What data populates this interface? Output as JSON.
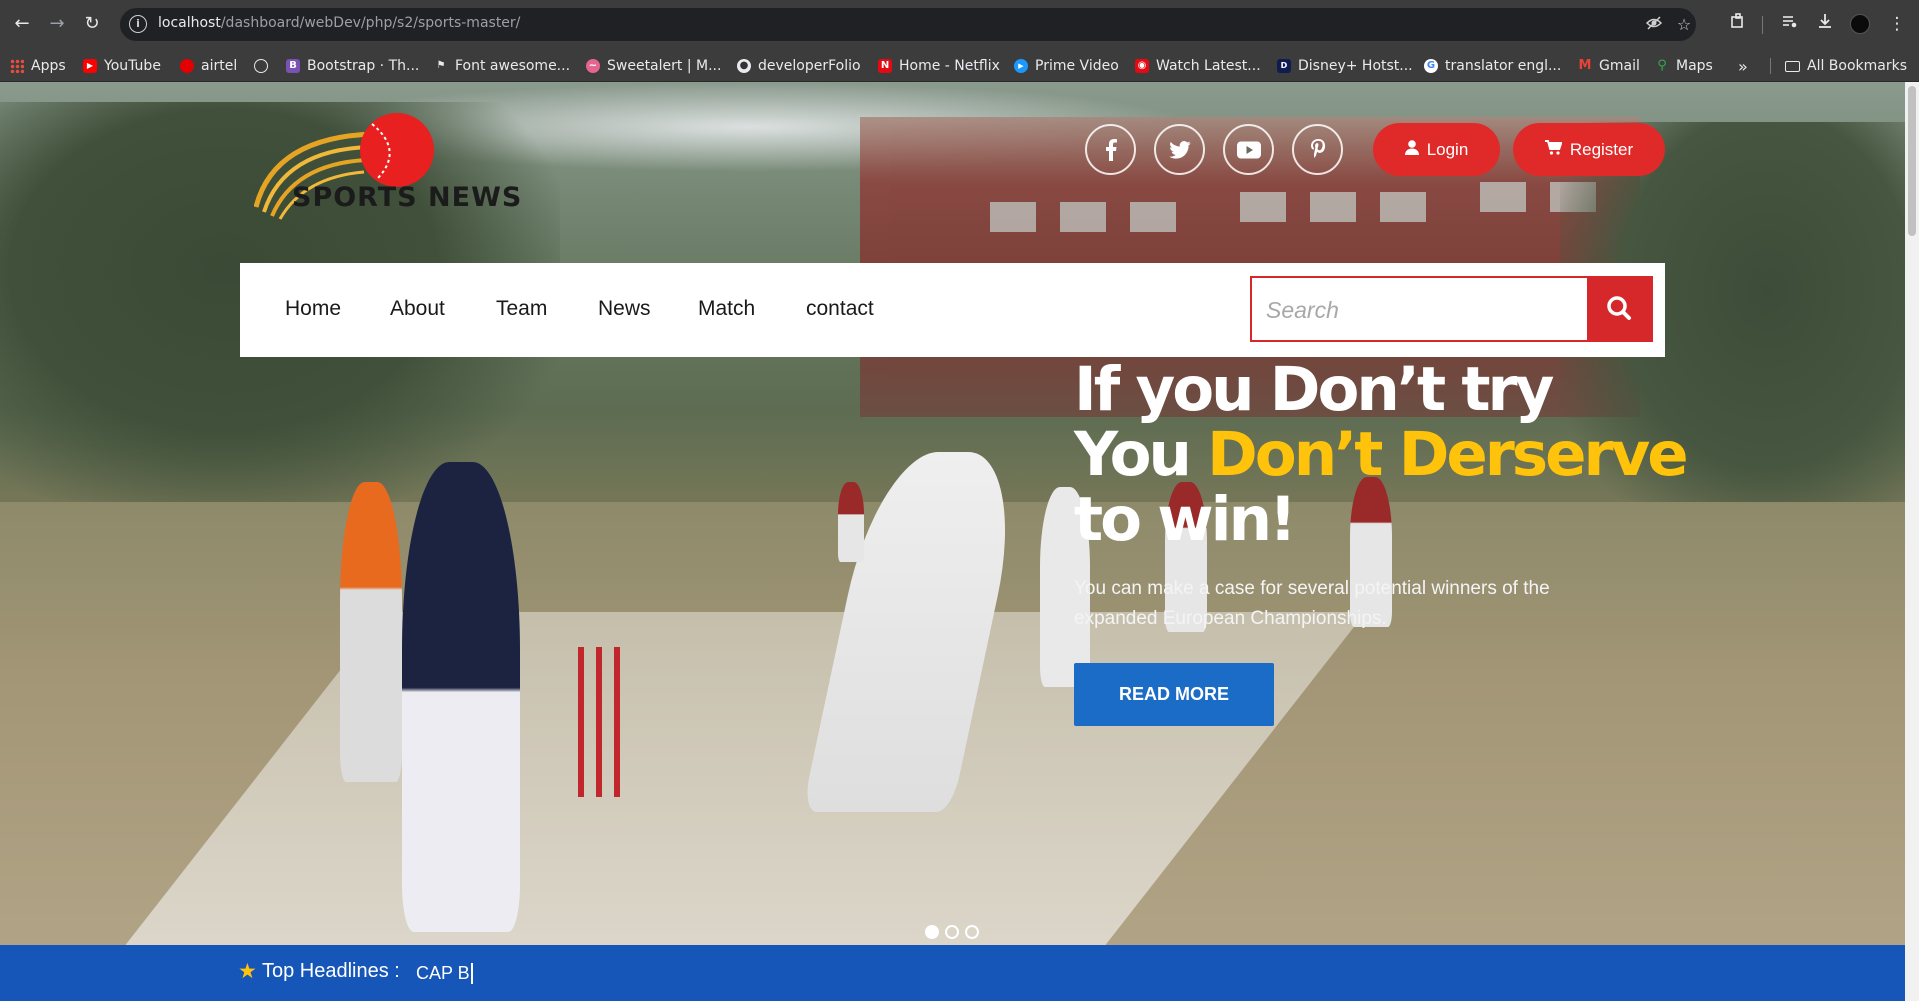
{
  "browser": {
    "url_host": "localhost",
    "url_path": "/dashboard/webDev/php/s2/sports-master/",
    "icons": [
      "back-icon",
      "forward-icon",
      "reload-icon",
      "site-info-icon",
      "eye-off-icon",
      "star-icon",
      "extensions-icon",
      "media-icon",
      "download-icon",
      "profile-icon",
      "menu-icon"
    ],
    "bookmarks": [
      {
        "label": "Apps",
        "icon": "apps-grid-icon",
        "color": "#e84c3d"
      },
      {
        "label": "YouTube",
        "icon": "youtube-icon",
        "color": "#ff0000"
      },
      {
        "label": "airtel",
        "icon": "airtel-icon",
        "color": "#e40000"
      },
      {
        "label": "",
        "icon": "globe-icon",
        "color": "#e8eaed"
      },
      {
        "label": "Bootstrap · Th...",
        "icon": "bootstrap-icon",
        "color": "#7952b3"
      },
      {
        "label": "Font awesome...",
        "icon": "font-awesome-icon",
        "color": "#e8eaed"
      },
      {
        "label": "Sweetalert | M...",
        "icon": "sweetalert-icon",
        "color": "#e36590"
      },
      {
        "label": "developerFolio",
        "icon": "github-icon",
        "color": "#e8eaed"
      },
      {
        "label": "Home - Netflix",
        "icon": "netflix-icon",
        "color": "#e50914"
      },
      {
        "label": "Prime Video",
        "icon": "prime-video-icon",
        "color": "#1a98ff"
      },
      {
        "label": "Watch Latest...",
        "icon": "watch-icon",
        "color": "#e50914"
      },
      {
        "label": "Disney+ Hotst...",
        "icon": "disney-hotstar-icon",
        "color": "#0f1c4f"
      },
      {
        "label": "translator engl...",
        "icon": "google-icon",
        "color": "#4285f4"
      },
      {
        "label": "Gmail",
        "icon": "gmail-icon",
        "color": "#ea4335"
      },
      {
        "label": "Maps",
        "icon": "maps-icon",
        "color": "#34a853"
      }
    ],
    "more_label": "»",
    "all_bookmarks_label": "All Bookmarks"
  },
  "site": {
    "logo_text": "SPORTS NEWS",
    "social": [
      "facebook-icon",
      "twitter-icon",
      "youtube-icon",
      "pinterest-icon"
    ],
    "login_label": "Login",
    "register_label": "Register",
    "nav": [
      "Home",
      "About",
      "Team",
      "News",
      "Match",
      "contact"
    ],
    "search_placeholder": "Search",
    "hero": {
      "line1": "If you Don’t try",
      "line2_white": "You ",
      "line2_accent": "Don’t Derserve",
      "line3": "to win!",
      "subtext": "You can make a case for several potential winners of the expanded European Championships.",
      "button": "READ MORE"
    },
    "slider_dots": 3,
    "active_slide": 1,
    "ticker_label": "Top Headlines :",
    "ticker_text": "CAP B"
  },
  "colors": {
    "red": "#e02a2a",
    "yellow": "#ffc30b",
    "blue": "#1b6cc6",
    "ticker_blue": "#1556b8"
  }
}
